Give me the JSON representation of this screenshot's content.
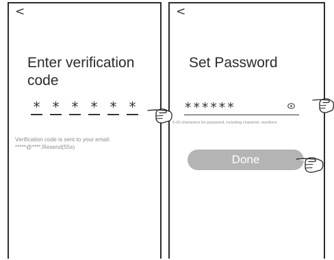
{
  "icons": {
    "back": "back-arrow-icon",
    "eye": "eye-icon",
    "hand": "pointing-hand-icon"
  },
  "verify_screen": {
    "back_glyph": "<",
    "title_line1": "Enter verification",
    "title_line2": "code",
    "code_chars": [
      "*",
      "*",
      "*",
      "*",
      "*",
      "*"
    ],
    "info_line1": "Verification code is sent to your email:",
    "info_line2": "*****@****,Resend(55s)"
  },
  "password_screen": {
    "back_glyph": "<",
    "title": "Set Password",
    "password_value": "******",
    "requirements": "6-20 characters for password, including character, numbers",
    "done_label": "Done"
  },
  "colors": {
    "frame": "#2a2a2a",
    "button": "#b4b4b4",
    "hint_text": "#8a8a8a"
  }
}
